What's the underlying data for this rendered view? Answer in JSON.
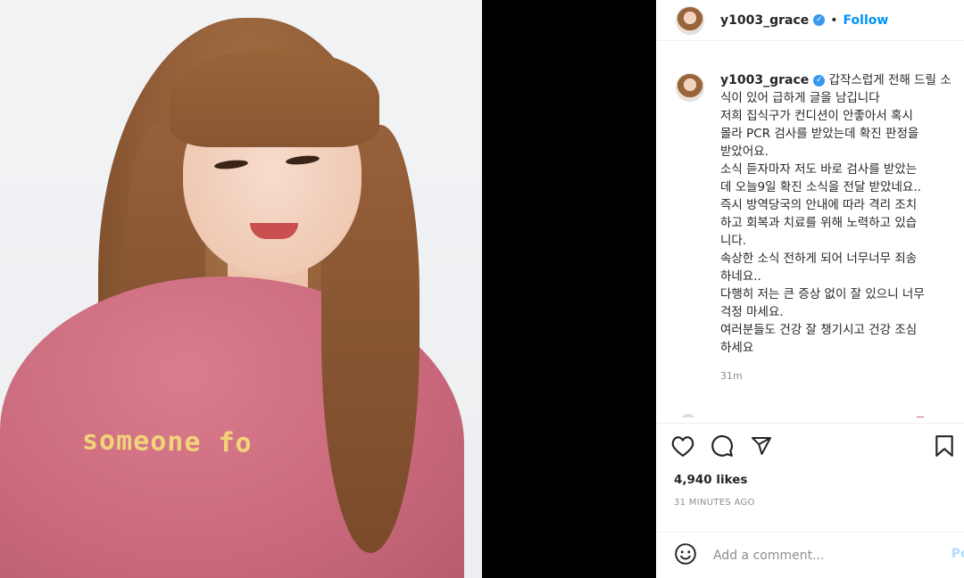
{
  "post": {
    "username": "y1003_grace",
    "follow_label": "Follow",
    "caption_lines": [
      "갑작스럽게 전해 드릴 소",
      "식이 있어 급하게 글을 남깁니다",
      "저희 집식구가 컨디션이 안좋아서 혹시",
      "몰라 PCR 검사를 받았는데 확진 판정을",
      "받았어요.",
      "소식 듣자마자 저도 바로 검사를 받았는",
      "데 오늘9일 확진 소식을 전달 받았네요..",
      "즉시 방역당국의 안내에 따라 격리 조치",
      "하고 회복과 치료를 위해 노력하고 있습",
      "니다.",
      "속상한 소식 전하게 되어 너무너무 죄송",
      "하네요..",
      "다행히 저는 큰 증상 없이 잘 있으니 너무",
      "걱정 마세요.",
      "여러분들도 건강 잘 챙기시고 건강 조심",
      "하세요"
    ],
    "caption_time": "31m",
    "likes": "4,940 likes",
    "posted_ago": "31 MINUTES AGO",
    "comment_placeholder": "Add a comment...",
    "post_button": "Pos",
    "shirt_text": "someone fo"
  },
  "icons": {
    "verified": "verified-badge-icon",
    "like": "heart-icon",
    "comment": "comment-bubble-icon",
    "share": "paper-plane-icon",
    "save": "bookmark-icon",
    "emoji": "smiley-icon"
  },
  "colors": {
    "link_blue": "#0095f6",
    "verified_blue": "#3897f0",
    "muted_gray": "#8e8e8e",
    "sweater_pink": "#c9687b"
  }
}
